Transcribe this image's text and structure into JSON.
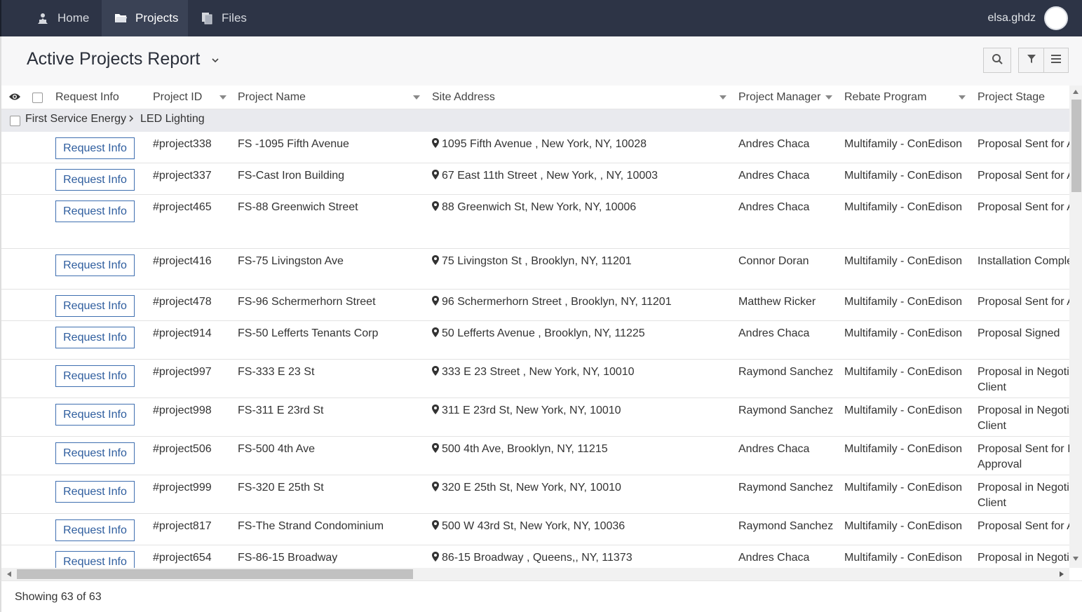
{
  "nav": {
    "items": [
      {
        "label": "Home",
        "icon": "home-icon"
      },
      {
        "label": "Projects",
        "icon": "folder-icon"
      },
      {
        "label": "Files",
        "icon": "files-icon"
      }
    ],
    "username": "elsa.ghdz"
  },
  "page": {
    "title": "Active Projects Report"
  },
  "table": {
    "columns": [
      "Request Info",
      "Project ID",
      "Project Name",
      "Site Address",
      "Project Manager",
      "Rebate Program",
      "Project Stage"
    ],
    "group": {
      "parent": "First Service Energy",
      "child": "LED Lighting"
    },
    "button_label": "Request Info",
    "rows": [
      {
        "id": "#project338",
        "name": "FS -1095 Fifth Avenue",
        "address": "1095 Fifth Avenue , New York, NY, 10028",
        "manager": "Andres Chaca",
        "program": "Multifamily - ConEdison",
        "stage": "Proposal Sent for A"
      },
      {
        "id": "#project337",
        "name": "FS-Cast Iron Building",
        "address": "67 East 11th Street , New York, , NY, 10003",
        "manager": "Andres Chaca",
        "program": "Multifamily - ConEdison",
        "stage": "Proposal Sent for A"
      },
      {
        "id": "#project465",
        "name": "FS-88 Greenwich Street",
        "address": "88 Greenwich St, New York, NY, 10006",
        "manager": "Andres Chaca",
        "program": "Multifamily - ConEdison",
        "stage": "Proposal Sent for A"
      },
      {
        "id": "#project416",
        "name": "FS-75 Livingston Ave",
        "address": "75 Livingston St , Brooklyn, NY, 11201",
        "manager": "Connor Doran",
        "program": "Multifamily - ConEdison",
        "stage": "Installation Comple"
      },
      {
        "id": "#project478",
        "name": "FS-96 Schermerhorn Street",
        "address": "96 Schermerhorn Street , Brooklyn, NY, 11201",
        "manager": "Matthew Ricker",
        "program": "Multifamily - ConEdison",
        "stage": "Proposal Sent for A"
      },
      {
        "id": "#project914",
        "name": "FS-50 Lefferts Tenants Corp",
        "address": "50 Lefferts Avenue , Brooklyn, NY, 11225",
        "manager": "Andres Chaca",
        "program": "Multifamily - ConEdison",
        "stage": "Proposal Signed"
      },
      {
        "id": "#project997",
        "name": "FS-333 E 23 St",
        "address": "333 E 23 Street , New York, NY, 10010",
        "manager": "Raymond Sanchez",
        "program": "Multifamily - ConEdison",
        "stage": "Proposal in Negotia",
        "stage2": "Client"
      },
      {
        "id": "#project998",
        "name": "FS-311 E 23rd St",
        "address": "311 E 23rd St, New York, NY, 10010",
        "manager": "Raymond Sanchez",
        "program": "Multifamily - ConEdison",
        "stage": "Proposal in Negotia",
        "stage2": "Client"
      },
      {
        "id": "#project506",
        "name": "FS-500 4th Ave",
        "address": "500 4th Ave, Brooklyn, NY, 11215",
        "manager": "Andres Chaca",
        "program": "Multifamily - ConEdison",
        "stage": "Proposal Sent for In",
        "stage2": "Approval"
      },
      {
        "id": "#project999",
        "name": "FS-320 E 25th St",
        "address": "320 E 25th St, New York, NY, 10010",
        "manager": "Raymond Sanchez",
        "program": "Multifamily - ConEdison",
        "stage": "Proposal in Negotia",
        "stage2": "Client"
      },
      {
        "id": "#project817",
        "name": "FS-The Strand Condominium",
        "address": "500 W 43rd St, New York, NY, 10036",
        "manager": "Raymond Sanchez",
        "program": "Multifamily - ConEdison",
        "stage": "Proposal Sent for A"
      },
      {
        "id": "#project654",
        "name": "FS-86-15 Broadway",
        "address": "86-15 Broadway , Queens,, NY, 11373",
        "manager": "Andres Chaca",
        "program": "Multifamily - ConEdison",
        "stage": "Proposal in Negotia"
      }
    ]
  },
  "footer": {
    "status": "Showing 63 of 63"
  }
}
